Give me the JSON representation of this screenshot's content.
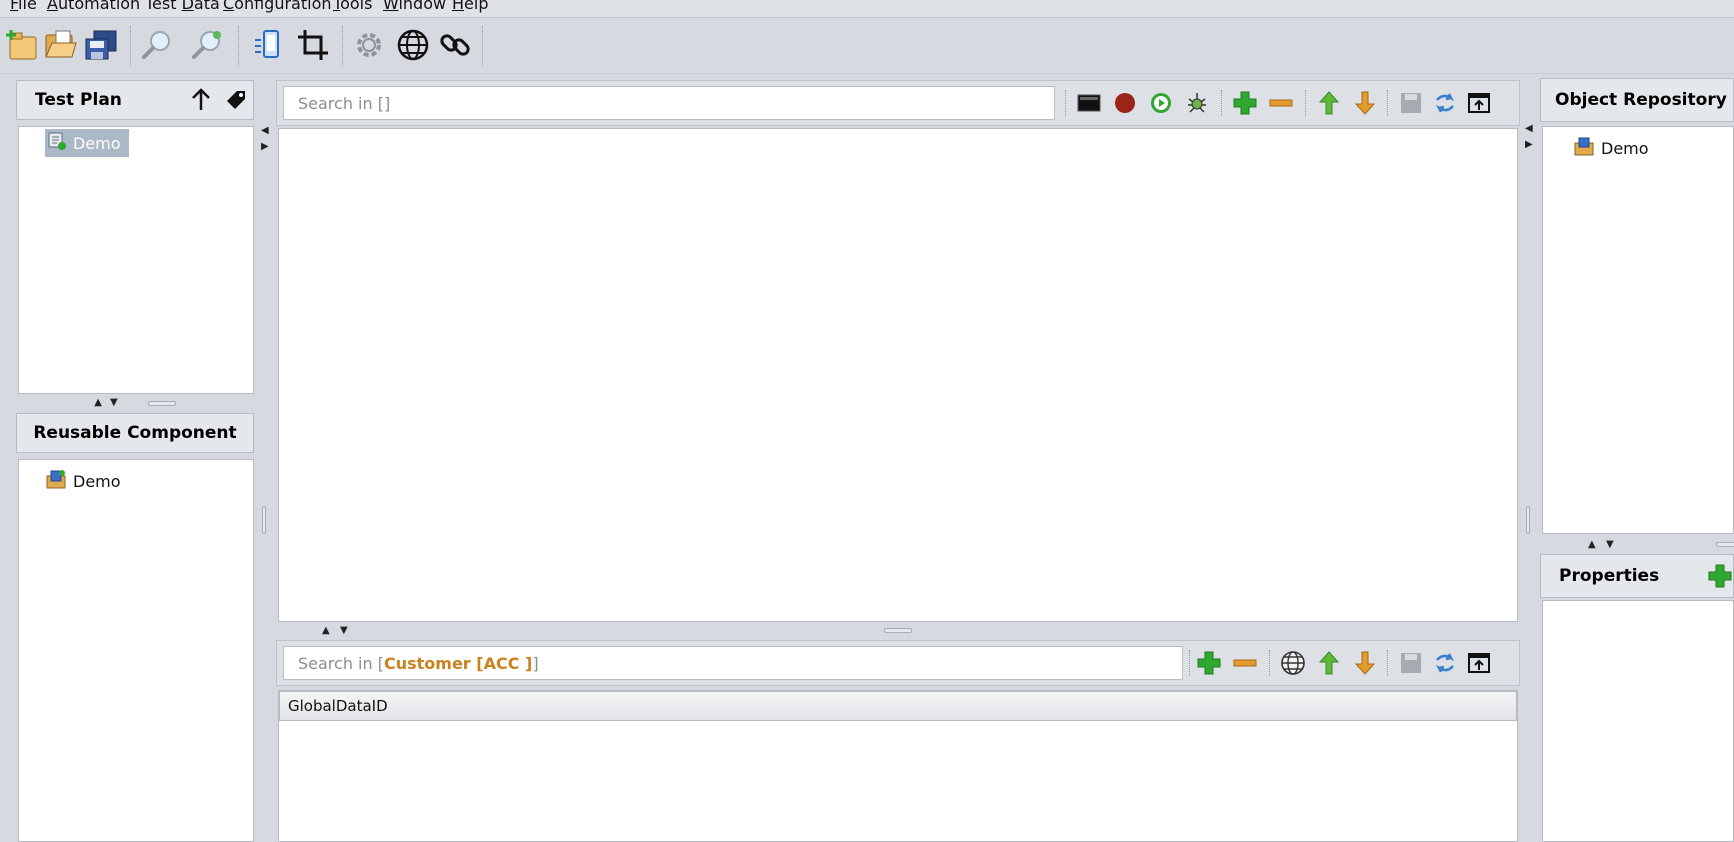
{
  "menu": {
    "items": [
      {
        "pre": "",
        "u": "F",
        "post": "ile"
      },
      {
        "pre": "",
        "u": "A",
        "post": "utomation"
      },
      {
        "pre": "Test ",
        "u": "D",
        "post": "ata"
      },
      {
        "pre": "",
        "u": "C",
        "post": "onfiguration"
      },
      {
        "pre": "",
        "u": "T",
        "post": "ools"
      },
      {
        "pre": "",
        "u": "W",
        "post": "indow"
      },
      {
        "pre": "",
        "u": "H",
        "post": "elp"
      }
    ]
  },
  "toolbar": {
    "icons": [
      "new-project-icon",
      "open-project-icon",
      "save-all-icon",
      "search-icon",
      "search-settings-icon",
      "mobile-device-icon",
      "crop-icon",
      "settings-gear-icon",
      "globe-icon",
      "link-icon"
    ]
  },
  "test_plan": {
    "title": "Test Plan",
    "items": [
      "Demo"
    ]
  },
  "reusable": {
    "title": "Reusable Component",
    "items": [
      "Demo"
    ]
  },
  "editor": {
    "search_prefix": "Search in [",
    "search_scope": " ",
    "search_suffix": "]"
  },
  "test_data": {
    "search_prefix": "Search in [ ",
    "search_scope": "Customer [ACC ]",
    "search_suffix": " ]",
    "columns": [
      "GlobalDataID"
    ]
  },
  "object_repository": {
    "title": "Object Repository",
    "items": [
      "Demo"
    ]
  },
  "properties": {
    "title": "Properties"
  },
  "colors": {
    "accent_green": "#2fa82f",
    "accent_orange": "#e59a2c",
    "highlight": "#c9821e",
    "record_red": "#9b2418"
  }
}
